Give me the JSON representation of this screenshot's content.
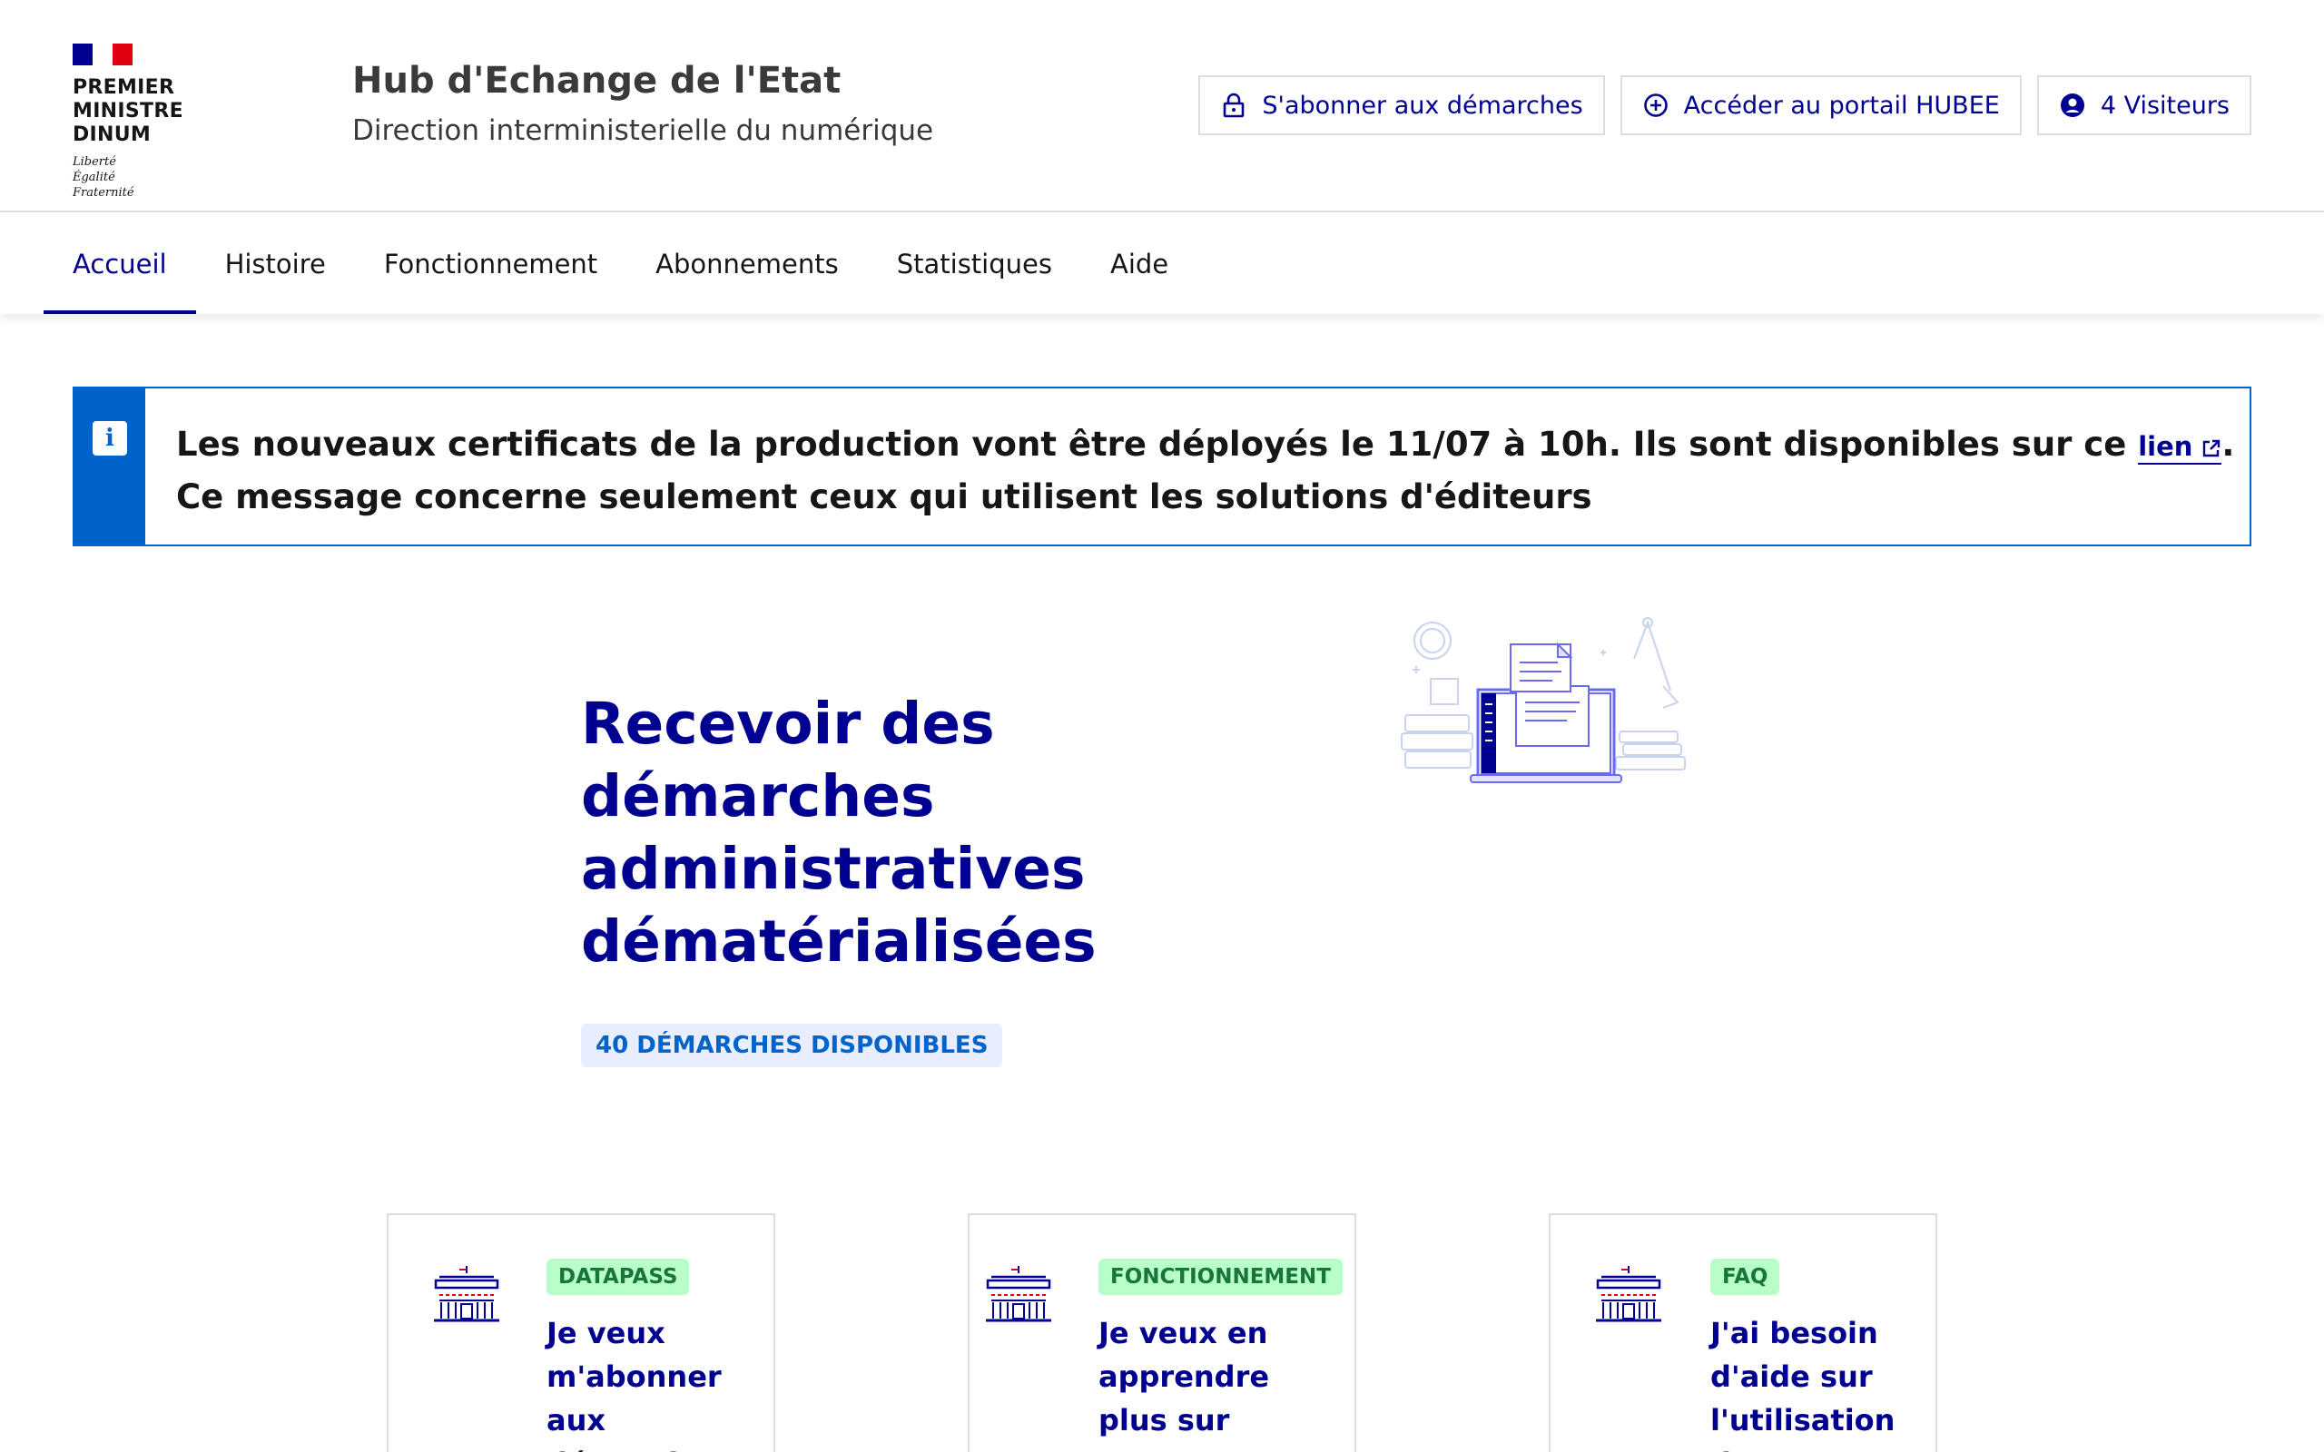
{
  "header": {
    "ministry_lines": [
      "PREMIER MINISTRE",
      "DINUM"
    ],
    "motto": [
      "Liberté",
      "Égalité",
      "Fraternité"
    ],
    "service_title": "Hub d'Echange de l'Etat",
    "service_tagline": "Direction interministerielle du numérique",
    "tools": [
      {
        "label": "S'abonner aux démarches",
        "icon": "lock-icon"
      },
      {
        "label": "Accéder au portail HUBEE",
        "icon": "add-circle-icon"
      },
      {
        "label": "4 Visiteurs",
        "icon": "account-circle-icon"
      }
    ]
  },
  "nav": {
    "items": [
      {
        "label": "Accueil",
        "active": true
      },
      {
        "label": "Histoire"
      },
      {
        "label": "Fonctionnement"
      },
      {
        "label": "Abonnements"
      },
      {
        "label": "Statistiques"
      },
      {
        "label": "Aide"
      }
    ]
  },
  "notice": {
    "line1_prefix": "Les nouveaux certificats de la production vont être déployés le 11/07 à 10h. Ils sont disponibles sur ce ",
    "link_label": "lien",
    "line1_suffix": ".",
    "line2": "Ce message concerne seulement ceux qui utilisent les solutions d'éditeurs"
  },
  "hero": {
    "title": "Recevoir des démarches administratives dématérialisées",
    "badge": "40 démarches disponibles"
  },
  "cards": [
    {
      "tag": "DATAPASS",
      "title": "Je veux m'abonner aux démarches"
    },
    {
      "tag": "FONCTIONNEMENT",
      "title": "Je veux en apprendre plus sur HUBEE"
    },
    {
      "tag": "FAQ",
      "title": "J'ai besoin d'aide sur l'utilisation de HUBEE"
    }
  ],
  "colors": {
    "primary": "#000091",
    "info": "#0063cb",
    "success_bg": "#b8fec9",
    "success_text": "#18753c",
    "badge_bg": "#e8edff"
  }
}
